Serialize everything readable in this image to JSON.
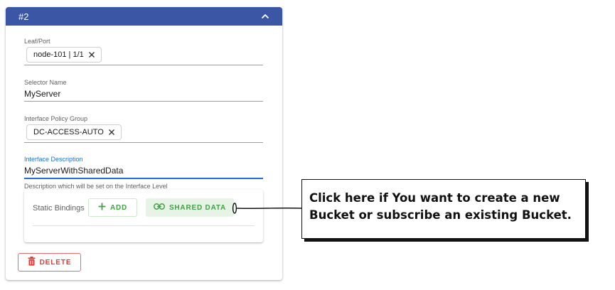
{
  "panel": {
    "title": "#2"
  },
  "fields": {
    "leaf_port": {
      "label": "Leaf/Port",
      "chip": "node-101 | 1/1"
    },
    "selector_name": {
      "label": "Selector Name",
      "value": "MyServer"
    },
    "interface_policy_group": {
      "label": "Interface Policy Group",
      "chip": "DC-ACCESS-AUTO"
    },
    "interface_description": {
      "label": "Interface Description",
      "value": "MyServerWithSharedData",
      "hint": "Description which will be set on the Interface Level"
    }
  },
  "static_bindings": {
    "label": "Static Bindings",
    "add_label": "ADD",
    "shared_data_label": "SHARED DATA"
  },
  "delete_label": "DELETE",
  "annotation": {
    "text": "Click here if You want to create a new Bucket or subscribe an existing Bucket."
  },
  "colors": {
    "header": "#3a56a5",
    "accent_blue": "#1e6fd9",
    "green": "#43a047",
    "red": "#e53935"
  },
  "icons": {
    "collapse": "chevron-up-icon",
    "chip_remove": "close-icon",
    "add": "plus-icon",
    "shared": "link-icon",
    "delete": "trash-icon"
  }
}
